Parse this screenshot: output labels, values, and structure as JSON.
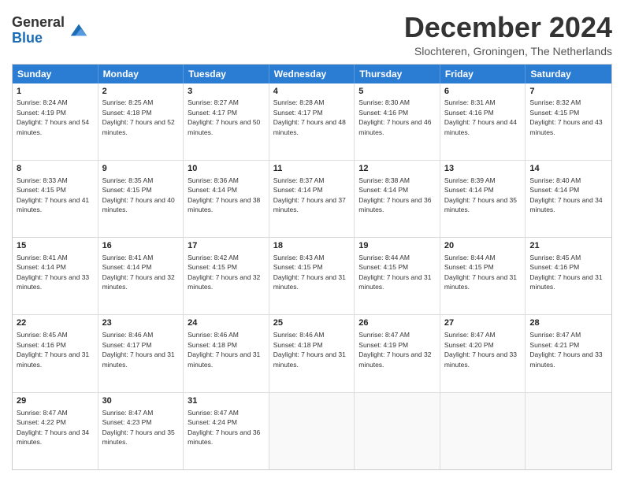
{
  "header": {
    "logo": {
      "line1": "General",
      "line2": "Blue"
    },
    "title": "December 2024",
    "subtitle": "Slochteren, Groningen, The Netherlands"
  },
  "weekdays": [
    "Sunday",
    "Monday",
    "Tuesday",
    "Wednesday",
    "Thursday",
    "Friday",
    "Saturday"
  ],
  "rows": [
    [
      {
        "day": "1",
        "sunrise": "Sunrise: 8:24 AM",
        "sunset": "Sunset: 4:19 PM",
        "daylight": "Daylight: 7 hours and 54 minutes."
      },
      {
        "day": "2",
        "sunrise": "Sunrise: 8:25 AM",
        "sunset": "Sunset: 4:18 PM",
        "daylight": "Daylight: 7 hours and 52 minutes."
      },
      {
        "day": "3",
        "sunrise": "Sunrise: 8:27 AM",
        "sunset": "Sunset: 4:17 PM",
        "daylight": "Daylight: 7 hours and 50 minutes."
      },
      {
        "day": "4",
        "sunrise": "Sunrise: 8:28 AM",
        "sunset": "Sunset: 4:17 PM",
        "daylight": "Daylight: 7 hours and 48 minutes."
      },
      {
        "day": "5",
        "sunrise": "Sunrise: 8:30 AM",
        "sunset": "Sunset: 4:16 PM",
        "daylight": "Daylight: 7 hours and 46 minutes."
      },
      {
        "day": "6",
        "sunrise": "Sunrise: 8:31 AM",
        "sunset": "Sunset: 4:16 PM",
        "daylight": "Daylight: 7 hours and 44 minutes."
      },
      {
        "day": "7",
        "sunrise": "Sunrise: 8:32 AM",
        "sunset": "Sunset: 4:15 PM",
        "daylight": "Daylight: 7 hours and 43 minutes."
      }
    ],
    [
      {
        "day": "8",
        "sunrise": "Sunrise: 8:33 AM",
        "sunset": "Sunset: 4:15 PM",
        "daylight": "Daylight: 7 hours and 41 minutes."
      },
      {
        "day": "9",
        "sunrise": "Sunrise: 8:35 AM",
        "sunset": "Sunset: 4:15 PM",
        "daylight": "Daylight: 7 hours and 40 minutes."
      },
      {
        "day": "10",
        "sunrise": "Sunrise: 8:36 AM",
        "sunset": "Sunset: 4:14 PM",
        "daylight": "Daylight: 7 hours and 38 minutes."
      },
      {
        "day": "11",
        "sunrise": "Sunrise: 8:37 AM",
        "sunset": "Sunset: 4:14 PM",
        "daylight": "Daylight: 7 hours and 37 minutes."
      },
      {
        "day": "12",
        "sunrise": "Sunrise: 8:38 AM",
        "sunset": "Sunset: 4:14 PM",
        "daylight": "Daylight: 7 hours and 36 minutes."
      },
      {
        "day": "13",
        "sunrise": "Sunrise: 8:39 AM",
        "sunset": "Sunset: 4:14 PM",
        "daylight": "Daylight: 7 hours and 35 minutes."
      },
      {
        "day": "14",
        "sunrise": "Sunrise: 8:40 AM",
        "sunset": "Sunset: 4:14 PM",
        "daylight": "Daylight: 7 hours and 34 minutes."
      }
    ],
    [
      {
        "day": "15",
        "sunrise": "Sunrise: 8:41 AM",
        "sunset": "Sunset: 4:14 PM",
        "daylight": "Daylight: 7 hours and 33 minutes."
      },
      {
        "day": "16",
        "sunrise": "Sunrise: 8:41 AM",
        "sunset": "Sunset: 4:14 PM",
        "daylight": "Daylight: 7 hours and 32 minutes."
      },
      {
        "day": "17",
        "sunrise": "Sunrise: 8:42 AM",
        "sunset": "Sunset: 4:15 PM",
        "daylight": "Daylight: 7 hours and 32 minutes."
      },
      {
        "day": "18",
        "sunrise": "Sunrise: 8:43 AM",
        "sunset": "Sunset: 4:15 PM",
        "daylight": "Daylight: 7 hours and 31 minutes."
      },
      {
        "day": "19",
        "sunrise": "Sunrise: 8:44 AM",
        "sunset": "Sunset: 4:15 PM",
        "daylight": "Daylight: 7 hours and 31 minutes."
      },
      {
        "day": "20",
        "sunrise": "Sunrise: 8:44 AM",
        "sunset": "Sunset: 4:15 PM",
        "daylight": "Daylight: 7 hours and 31 minutes."
      },
      {
        "day": "21",
        "sunrise": "Sunrise: 8:45 AM",
        "sunset": "Sunset: 4:16 PM",
        "daylight": "Daylight: 7 hours and 31 minutes."
      }
    ],
    [
      {
        "day": "22",
        "sunrise": "Sunrise: 8:45 AM",
        "sunset": "Sunset: 4:16 PM",
        "daylight": "Daylight: 7 hours and 31 minutes."
      },
      {
        "day": "23",
        "sunrise": "Sunrise: 8:46 AM",
        "sunset": "Sunset: 4:17 PM",
        "daylight": "Daylight: 7 hours and 31 minutes."
      },
      {
        "day": "24",
        "sunrise": "Sunrise: 8:46 AM",
        "sunset": "Sunset: 4:18 PM",
        "daylight": "Daylight: 7 hours and 31 minutes."
      },
      {
        "day": "25",
        "sunrise": "Sunrise: 8:46 AM",
        "sunset": "Sunset: 4:18 PM",
        "daylight": "Daylight: 7 hours and 31 minutes."
      },
      {
        "day": "26",
        "sunrise": "Sunrise: 8:47 AM",
        "sunset": "Sunset: 4:19 PM",
        "daylight": "Daylight: 7 hours and 32 minutes."
      },
      {
        "day": "27",
        "sunrise": "Sunrise: 8:47 AM",
        "sunset": "Sunset: 4:20 PM",
        "daylight": "Daylight: 7 hours and 33 minutes."
      },
      {
        "day": "28",
        "sunrise": "Sunrise: 8:47 AM",
        "sunset": "Sunset: 4:21 PM",
        "daylight": "Daylight: 7 hours and 33 minutes."
      }
    ],
    [
      {
        "day": "29",
        "sunrise": "Sunrise: 8:47 AM",
        "sunset": "Sunset: 4:22 PM",
        "daylight": "Daylight: 7 hours and 34 minutes."
      },
      {
        "day": "30",
        "sunrise": "Sunrise: 8:47 AM",
        "sunset": "Sunset: 4:23 PM",
        "daylight": "Daylight: 7 hours and 35 minutes."
      },
      {
        "day": "31",
        "sunrise": "Sunrise: 8:47 AM",
        "sunset": "Sunset: 4:24 PM",
        "daylight": "Daylight: 7 hours and 36 minutes."
      },
      null,
      null,
      null,
      null
    ]
  ]
}
